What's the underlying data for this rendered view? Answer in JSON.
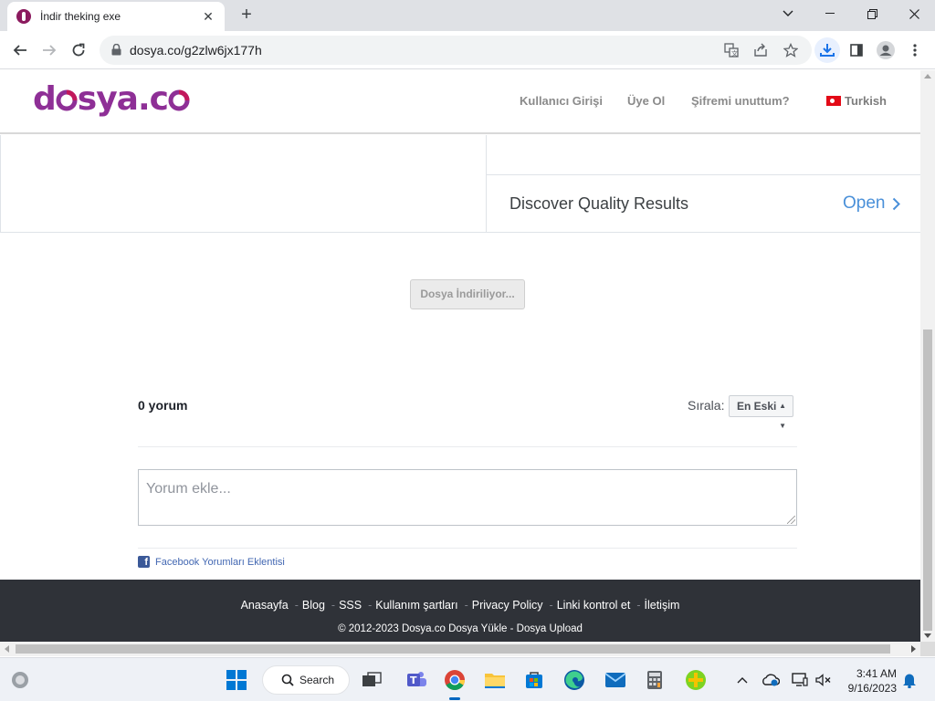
{
  "browser": {
    "tab_title": "İndir theking exe",
    "url": "dosya.co/g2zlw6jx177h"
  },
  "site": {
    "logo_text_1": "d",
    "logo_text_2": "sya.c",
    "nav": {
      "login": "Kullanıcı Girişi",
      "register": "Üye Ol",
      "forgot": "Şifremi unuttum?",
      "language": "Turkish"
    },
    "ad": {
      "text": "Discover Quality Results",
      "cta": "Open"
    },
    "download_status": "Dosya İndiriliyor...",
    "comments": {
      "count": "0 yorum",
      "sort_label": "Sırala:",
      "sort_value": "En Eski",
      "placeholder": "Yorum ekle...",
      "plugin": "Facebook Yorumları Eklentisi"
    },
    "footer": {
      "links": [
        "Anasayfa",
        "Blog",
        "SSS",
        "Kullanım şartları",
        "Privacy Policy",
        "Linki kontrol et",
        "İletişim"
      ],
      "copyright": "© 2012-2023 Dosya.co Dosya Yükle - Dosya Upload"
    }
  },
  "taskbar": {
    "search_label": "Search",
    "time": "3:41 AM",
    "date": "9/16/2023"
  },
  "colors": {
    "brand": "#8e2f96",
    "footer_bg": "#2f3238",
    "link_blue": "#4a90d9"
  }
}
